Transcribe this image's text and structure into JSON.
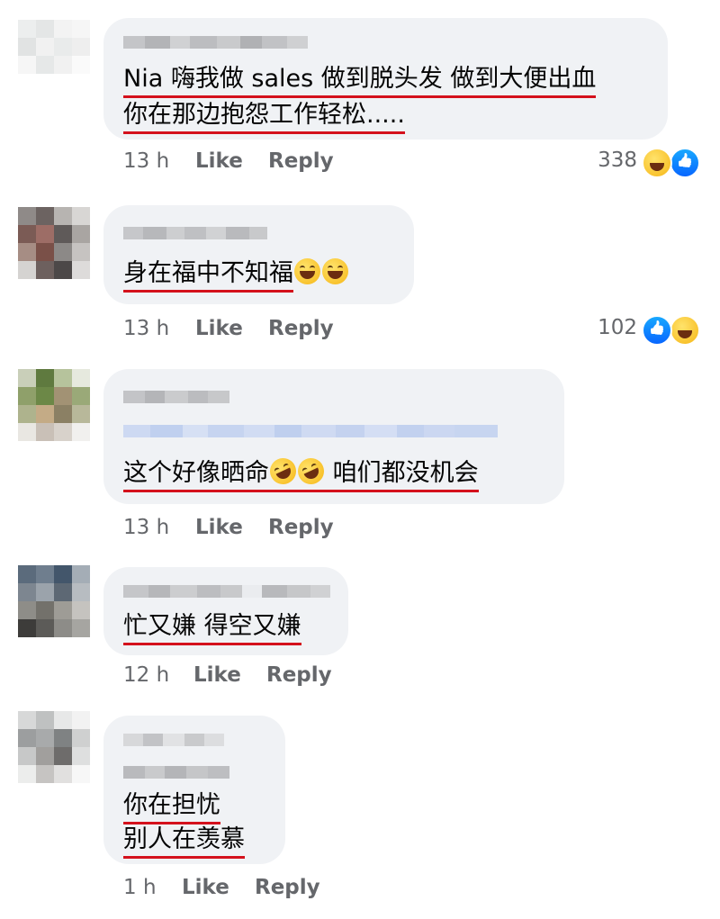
{
  "comments": [
    {
      "lines": [
        "Nia 嗨我做 sales 做到脱头发 做到大便出血",
        "你在那边抱怨工作轻松....."
      ],
      "time": "13 h",
      "like_label": "Like",
      "reply_label": "Reply",
      "reaction_count": "338",
      "reaction_icons": [
        "haha-icon",
        "like-icon"
      ]
    },
    {
      "lines": [
        "身在福中不知福"
      ],
      "emoji_after_line": [
        "tears-of-joy-emoji",
        "tears-of-joy-emoji"
      ],
      "time": "13 h",
      "like_label": "Like",
      "reply_label": "Reply",
      "reaction_count": "102",
      "reaction_icons": [
        "like-icon",
        "haha-icon"
      ]
    },
    {
      "line_before_emoji": "这个好像晒命",
      "emoji_inline": [
        "rolling-on-floor-laughing-emoji",
        "rolling-on-floor-laughing-emoji"
      ],
      "line_after_emoji": "咱们都没机会",
      "time": "13 h",
      "like_label": "Like",
      "reply_label": "Reply"
    },
    {
      "lines": [
        "忙又嫌 得空又嫌"
      ],
      "time": "12 h",
      "like_label": "Like",
      "reply_label": "Reply"
    },
    {
      "lines": [
        "你在担忧",
        "别人在羡慕"
      ],
      "time": "1 h",
      "like_label": "Like",
      "reply_label": "Reply"
    }
  ],
  "colors": {
    "bubble": "#f0f2f5",
    "underline": "#d4111c",
    "meta_text": "#65676b",
    "like_blue": "#0866ff"
  }
}
